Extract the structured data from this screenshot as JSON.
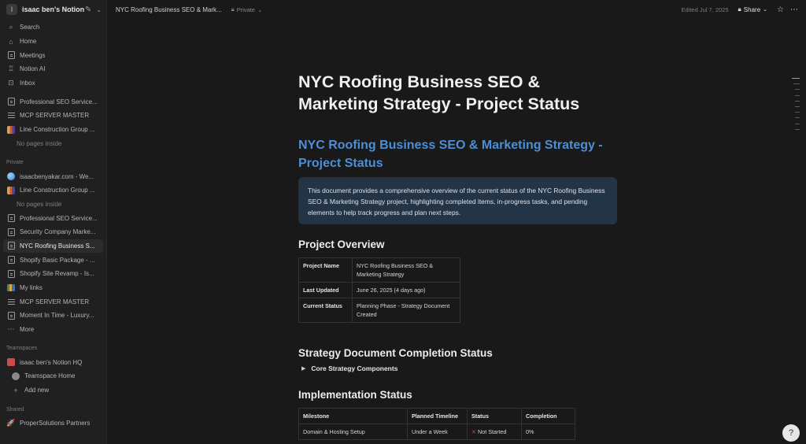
{
  "workspace": {
    "initial": "I",
    "name": "isaac ben's Notion"
  },
  "sidebar": {
    "top_items": [
      {
        "label": "Search",
        "icon": "search-icon"
      },
      {
        "label": "Home",
        "icon": "home-icon"
      },
      {
        "label": "Meetings",
        "icon": "meetings-icon"
      },
      {
        "label": "Notion AI",
        "icon": "notion-ai-icon"
      },
      {
        "label": "Inbox",
        "icon": "inbox-icon"
      }
    ],
    "favorites": [
      {
        "label": "Professional SEO Service...",
        "icon": "page-icon"
      },
      {
        "label": "MCP SERVER MASTER",
        "icon": "list-icon"
      },
      {
        "label": "Line Construction Group ...",
        "icon": "chart-icon"
      }
    ],
    "favorites_empty": "No pages inside",
    "private_label": "Private",
    "private": [
      {
        "label": "isaacbenyakar.com - We...",
        "icon": "globe-icon"
      },
      {
        "label": "Line Construction Group ...",
        "icon": "chart-icon"
      }
    ],
    "private_empty": "No pages inside",
    "private_more": [
      {
        "label": "Professional SEO Service...",
        "icon": "page-icon"
      },
      {
        "label": "Security Company Marke...",
        "icon": "page-icon"
      },
      {
        "label": "NYC Roofing Business S...",
        "icon": "page-icon",
        "active": true
      },
      {
        "label": "Shopify Basic Package - ...",
        "icon": "page-icon"
      },
      {
        "label": "Shopify Site Revamp - Is...",
        "icon": "page-icon"
      },
      {
        "label": "My links",
        "icon": "books-icon"
      },
      {
        "label": "MCP SERVER MASTER",
        "icon": "list-icon"
      },
      {
        "label": "Moment In Time - Luxury...",
        "icon": "page-icon"
      }
    ],
    "more_label": "More",
    "teamspaces_label": "Teamspaces",
    "teamspaces": [
      {
        "label": "isaac ben's Notion HQ",
        "icon": "house-icon"
      },
      {
        "label": "Teamspace Home",
        "icon": "teamspace-icon"
      },
      {
        "label": "Add new",
        "icon": "plus-icon"
      }
    ],
    "shared_label": "Shared",
    "shared": [
      {
        "label": "ProperSolutions Partners",
        "icon": "rocket-icon"
      }
    ]
  },
  "topbar": {
    "breadcrumb": "NYC Roofing Business SEO & Mark...",
    "privacy": "Private",
    "edited": "Edited Jul 7, 2025",
    "share": "Share"
  },
  "doc": {
    "title": "NYC Roofing Business SEO & Marketing Strategy - Project Status",
    "heading_blue": "NYC Roofing Business SEO & Marketing Strategy - Project Status",
    "callout": "This document provides a comprehensive overview of the current status of the NYC Roofing Business SEO & Marketing Strategy project, highlighting completed items, in-progress tasks, and pending elements to help track progress and plan next steps.",
    "overview_heading": "Project Overview",
    "overview_rows": [
      {
        "key": "Project Name",
        "value": "NYC Roofing Business SEO & Marketing Strategy"
      },
      {
        "key": "Last Updated",
        "value": "June 26, 2025 (4 days ago)"
      },
      {
        "key": "Current Status",
        "value": "Planning Phase - Strategy Document Created"
      }
    ],
    "completion_heading": "Strategy Document Completion Status",
    "toggle_label": "Core Strategy Components",
    "implementation_heading": "Implementation Status",
    "impl_headers": [
      "Milestone",
      "Planned Timeline",
      "Status",
      "Completion"
    ],
    "impl_rows": [
      {
        "milestone": "Domain & Hosting Setup",
        "timeline": "Under a Week",
        "status": "Not Started",
        "completion": "0%"
      }
    ]
  }
}
